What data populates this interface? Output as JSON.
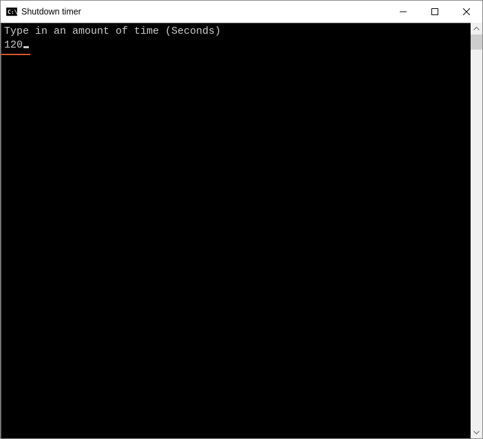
{
  "window": {
    "title": "Shutdown timer"
  },
  "console": {
    "prompt": "Type in an amount of time (Seconds)",
    "input": "120"
  }
}
